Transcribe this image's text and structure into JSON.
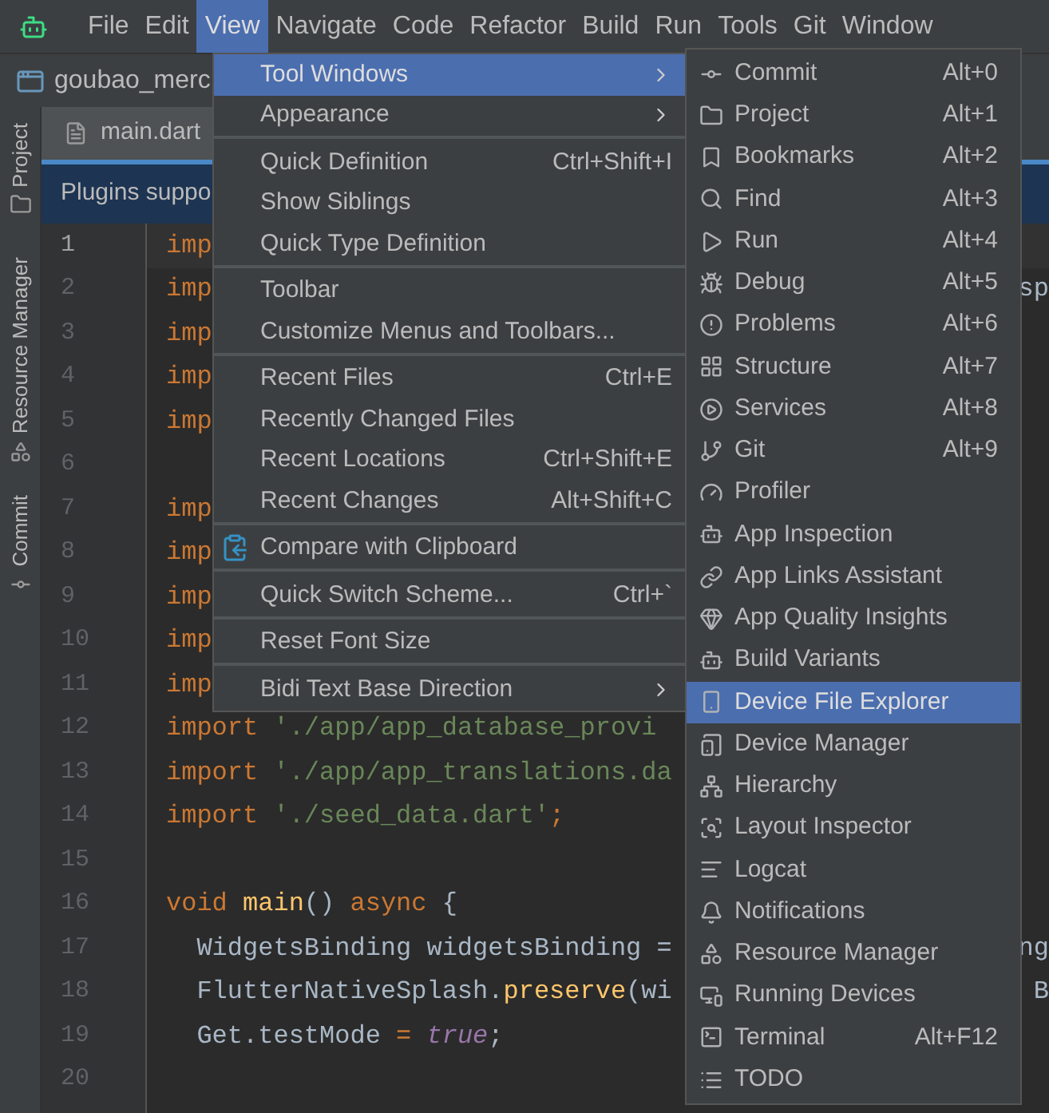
{
  "menu_bar": [
    {
      "label": "File",
      "selected": false
    },
    {
      "label": "Edit",
      "selected": false
    },
    {
      "label": "View",
      "selected": true
    },
    {
      "label": "Navigate",
      "selected": false
    },
    {
      "label": "Code",
      "selected": false
    },
    {
      "label": "Refactor",
      "selected": false
    },
    {
      "label": "Build",
      "selected": false
    },
    {
      "label": "Run",
      "selected": false
    },
    {
      "label": "Tools",
      "selected": false
    },
    {
      "label": "Git",
      "selected": false
    },
    {
      "label": "Window",
      "selected": false
    }
  ],
  "project_bar": {
    "title": "goubao_merc"
  },
  "left_stripe": [
    {
      "label": "Project"
    },
    {
      "label": "Resource Manager"
    },
    {
      "label": "Commit"
    }
  ],
  "editor_tab": {
    "label": "main.dart"
  },
  "banner": {
    "text": "Plugins suppo"
  },
  "editor": {
    "lines": [
      {
        "number": "1",
        "tokens": [
          {
            "kind": "keyword",
            "text": "imp"
          }
        ]
      },
      {
        "number": "2",
        "tokens": [
          {
            "kind": "keyword",
            "text": "imp"
          }
        ],
        "right": "sp"
      },
      {
        "number": "3",
        "tokens": [
          {
            "kind": "keyword",
            "text": "imp"
          }
        ]
      },
      {
        "number": "4",
        "tokens": [
          {
            "kind": "keyword",
            "text": "imp"
          }
        ]
      },
      {
        "number": "5",
        "tokens": [
          {
            "kind": "keyword",
            "text": "imp"
          }
        ]
      },
      {
        "number": "6"
      },
      {
        "number": "7",
        "tokens": [
          {
            "kind": "keyword",
            "text": "imp"
          }
        ]
      },
      {
        "number": "8",
        "tokens": [
          {
            "kind": "keyword",
            "text": "imp"
          }
        ]
      },
      {
        "number": "9",
        "tokens": [
          {
            "kind": "keyword",
            "text": "imp"
          }
        ]
      },
      {
        "number": "10",
        "tokens": [
          {
            "kind": "keyword",
            "text": "imp"
          }
        ]
      },
      {
        "number": "11",
        "tokens": [
          {
            "kind": "keyword",
            "text": "imp"
          }
        ]
      },
      {
        "number": "12",
        "tokens": [
          {
            "kind": "keyword",
            "text": "import "
          },
          {
            "kind": "string",
            "text": "'./app/app_database_provi"
          }
        ]
      },
      {
        "number": "13",
        "tokens": [
          {
            "kind": "keyword",
            "text": "import "
          },
          {
            "kind": "string",
            "text": "'./app/app_translations.da"
          }
        ]
      },
      {
        "number": "14",
        "tokens": [
          {
            "kind": "keyword",
            "text": "import "
          },
          {
            "kind": "string",
            "text": "'./seed_data.dart'"
          },
          {
            "kind": "keyword",
            "text": ";"
          }
        ]
      },
      {
        "number": "15"
      },
      {
        "number": "16",
        "tokens": [
          {
            "kind": "keyword",
            "text": "void "
          },
          {
            "kind": "function",
            "text": "main"
          },
          {
            "kind": "plain",
            "text": "() "
          },
          {
            "kind": "keyword",
            "text": "async "
          },
          {
            "kind": "plain",
            "text": "{"
          }
        ]
      },
      {
        "number": "17",
        "tokens": [
          {
            "kind": "plain",
            "text": "  WidgetsBinding widgetsBinding ="
          }
        ],
        "right": "ng"
      },
      {
        "number": "18",
        "tokens": [
          {
            "kind": "plain",
            "text": "  FlutterNativeSplash."
          },
          {
            "kind": "function",
            "text": "preserve"
          },
          {
            "kind": "plain",
            "text": "(wi"
          }
        ],
        "right": "B"
      },
      {
        "number": "19",
        "tokens": [
          {
            "kind": "plain",
            "text": "  Get.testMode "
          },
          {
            "kind": "keyword",
            "text": "= "
          },
          {
            "kind": "literal",
            "text": "true"
          },
          {
            "kind": "plain",
            "text": ";"
          }
        ]
      },
      {
        "number": "20"
      }
    ]
  },
  "view_menu": [
    {
      "kind": "item",
      "label": "Tool Windows",
      "submenu": true,
      "selected": true
    },
    {
      "kind": "item",
      "label": "Appearance",
      "submenu": true,
      "selected": false
    },
    {
      "kind": "separator"
    },
    {
      "kind": "item",
      "label": "Quick Definition",
      "shortcut": "Ctrl+Shift+I",
      "selected": false
    },
    {
      "kind": "item",
      "label": "Show Siblings",
      "selected": false
    },
    {
      "kind": "item",
      "label": "Quick Type Definition",
      "selected": false
    },
    {
      "kind": "separator"
    },
    {
      "kind": "item",
      "label": "Toolbar",
      "selected": false
    },
    {
      "kind": "item",
      "label": "Customize Menus and Toolbars...",
      "selected": false
    },
    {
      "kind": "separator"
    },
    {
      "kind": "item",
      "label": "Recent Files",
      "shortcut": "Ctrl+E",
      "selected": false
    },
    {
      "kind": "item",
      "label": "Recently Changed Files",
      "selected": false
    },
    {
      "kind": "item",
      "label": "Recent Locations",
      "shortcut": "Ctrl+Shift+E",
      "selected": false
    },
    {
      "kind": "item",
      "label": "Recent Changes",
      "shortcut": "Alt+Shift+C",
      "selected": false
    },
    {
      "kind": "separator"
    },
    {
      "kind": "item",
      "label": "Compare with Clipboard",
      "icon": true,
      "selected": false
    },
    {
      "kind": "separator"
    },
    {
      "kind": "item",
      "label": "Quick Switch Scheme...",
      "shortcut": "Ctrl+`",
      "selected": false
    },
    {
      "kind": "separator"
    },
    {
      "kind": "item",
      "label": "Reset Font Size",
      "selected": false
    },
    {
      "kind": "separator"
    },
    {
      "kind": "item",
      "label": "Bidi Text Base Direction",
      "submenu": true,
      "selected": false
    }
  ],
  "tool_windows_menu": [
    {
      "label": "Commit",
      "shortcut": "Alt+0",
      "selected": false
    },
    {
      "label": "Project",
      "shortcut": "Alt+1",
      "selected": false
    },
    {
      "label": "Bookmarks",
      "shortcut": "Alt+2",
      "selected": false
    },
    {
      "label": "Find",
      "shortcut": "Alt+3",
      "selected": false
    },
    {
      "label": "Run",
      "shortcut": "Alt+4",
      "selected": false
    },
    {
      "label": "Debug",
      "shortcut": "Alt+5",
      "selected": false
    },
    {
      "label": "Problems",
      "shortcut": "Alt+6",
      "selected": false
    },
    {
      "label": "Structure",
      "shortcut": "Alt+7",
      "selected": false
    },
    {
      "label": "Services",
      "shortcut": "Alt+8",
      "selected": false
    },
    {
      "label": "Git",
      "shortcut": "Alt+9",
      "selected": false
    },
    {
      "label": "Profiler",
      "selected": false
    },
    {
      "label": "App Inspection",
      "selected": false
    },
    {
      "label": "App Links Assistant",
      "selected": false
    },
    {
      "label": "App Quality Insights",
      "selected": false
    },
    {
      "label": "Build Variants",
      "selected": false
    },
    {
      "label": "Device File Explorer",
      "selected": true
    },
    {
      "label": "Device Manager",
      "selected": false
    },
    {
      "label": "Hierarchy",
      "selected": false
    },
    {
      "label": "Layout Inspector",
      "selected": false
    },
    {
      "label": "Logcat",
      "selected": false
    },
    {
      "label": "Notifications",
      "selected": false
    },
    {
      "label": "Resource Manager",
      "selected": false
    },
    {
      "label": "Running Devices",
      "selected": false
    },
    {
      "label": "Terminal",
      "shortcut": "Alt+F12",
      "selected": false
    },
    {
      "label": "TODO",
      "selected": false
    }
  ]
}
